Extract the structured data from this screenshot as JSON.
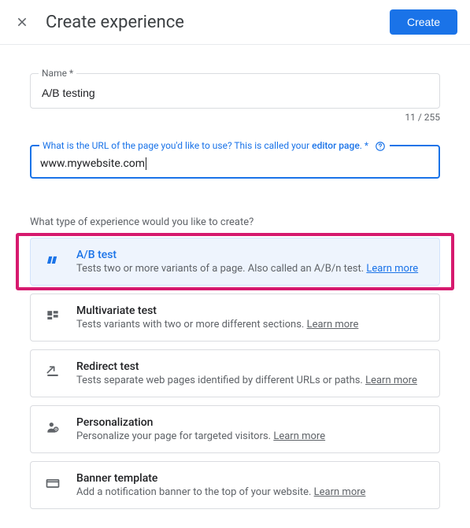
{
  "header": {
    "title": "Create experience",
    "create_button": "Create"
  },
  "name_field": {
    "label": "Name *",
    "value": "A/B testing",
    "count": "11 / 255"
  },
  "url_field": {
    "label_pre": "What is the URL of the page you'd like to use? This is called your ",
    "label_bold": "editor page",
    "label_post": ".",
    "required_mark": " *",
    "value": "www.mywebsite.com"
  },
  "type_section": {
    "question": "What type of experience would you like to create?",
    "learn_more_label": "Learn more",
    "options": [
      {
        "key": "ab",
        "title": "A/B test",
        "desc": "Tests two or more variants of a page. Also called an A/B/n test. ",
        "selected": true
      },
      {
        "key": "mvt",
        "title": "Multivariate test",
        "desc": "Tests variants with two or more different sections. "
      },
      {
        "key": "redirect",
        "title": "Redirect test",
        "desc": "Tests separate web pages identified by different URLs or paths. "
      },
      {
        "key": "personalization",
        "title": "Personalization",
        "desc": "Personalize your page for targeted visitors. "
      },
      {
        "key": "banner",
        "title": "Banner template",
        "desc": "Add a notification banner to the top of your website. "
      }
    ]
  }
}
